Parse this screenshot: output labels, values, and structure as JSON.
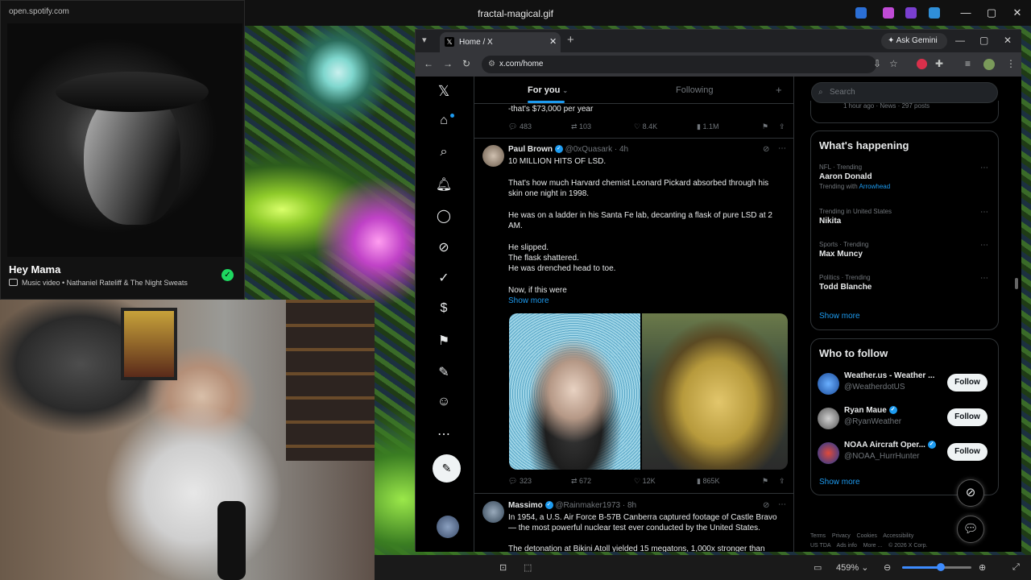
{
  "viewer": {
    "filename": "fractal-magical.gif"
  },
  "spotify": {
    "url": "open.spotify.com",
    "track_title": "Hey Mama",
    "subtitle": "Music video • Nathaniel Rateliff & The Night Sweats"
  },
  "browser": {
    "tab_title": "Home / X",
    "ask_gemini": "Ask Gemini",
    "url": "x.com/home"
  },
  "x": {
    "tabs": {
      "for_you": "For you",
      "following": "Following"
    },
    "prev_tweet": {
      "text_tail": "-that's $73,000 per year",
      "replies": "483",
      "reposts": "103",
      "likes": "8.4K",
      "views": "1.1M"
    },
    "tweet1": {
      "name": "Paul Brown",
      "handle_time": "@0xQuasark · 4h",
      "p1": "10 MILLION HITS OF LSD.",
      "p2": "That's how much Harvard chemist Leonard Pickard absorbed through his skin one night in 1998.",
      "p3": "He was on a ladder in his Santa Fe lab, decanting a flask of pure LSD at 2 AM.",
      "p4a": "He slipped.",
      "p4b": "The flask shattered.",
      "p4c": "He was drenched head to toe.",
      "p5": "Now, if this were",
      "show_more": "Show more",
      "replies": "323",
      "reposts": "672",
      "likes": "12K",
      "views": "865K"
    },
    "tweet2": {
      "name": "Massimo",
      "handle_time": "@Rainmaker1973 · 8h",
      "text": "In 1954, a U.S. Air Force B-57B Canberra captured footage of Castle Bravo — the most powerful nuclear test ever conducted by the United States.",
      "text2": "The detonation at Bikini Atoll yielded 15 megatons, 1,000x stronger than"
    },
    "search_placeholder": "Search",
    "news_meta": "1 hour ago · News · 297 posts",
    "whats_happening": {
      "title": "What's happening",
      "items": [
        {
          "category": "NFL · Trending",
          "name": "Aaron Donald",
          "extra_prefix": "Trending with",
          "extra_link": "Arrowhead"
        },
        {
          "category": "Trending in United States",
          "name": "Nikita"
        },
        {
          "category": "Sports · Trending",
          "name": "Max Muncy"
        },
        {
          "category": "Politics · Trending",
          "name": "Todd Blanche"
        }
      ],
      "show_more": "Show more"
    },
    "who_to_follow": {
      "title": "Who to follow",
      "accounts": [
        {
          "name": "Weather.us - Weather ...",
          "handle": "@WeatherdotUS",
          "button": "Follow"
        },
        {
          "name": "Ryan Maue",
          "handle": "@RyanWeather",
          "button": "Follow"
        },
        {
          "name": "NOAA Aircraft Oper...",
          "handle": "@NOAA_HurrHunter",
          "button": "Follow"
        }
      ],
      "show_more": "Show more"
    },
    "footer": {
      "l1": "Terms    Privacy    Cookies    Accessibility",
      "l2": "US TDA    Ads info    More ...    © 2026 X Corp."
    }
  },
  "viewer_bottom": {
    "zoom": "459%"
  }
}
